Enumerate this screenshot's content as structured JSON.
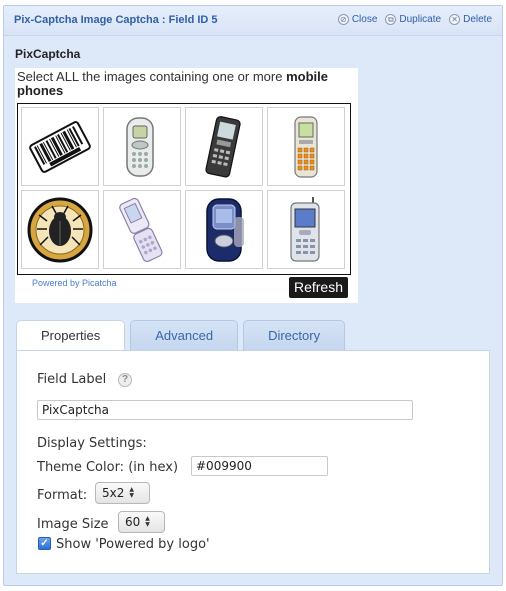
{
  "header": {
    "title": "Pix-Captcha Image Captcha : Field ID 5",
    "actions": {
      "close": "Close",
      "duplicate": "Duplicate",
      "delete": "Delete"
    }
  },
  "field_name": "PixCaptcha",
  "captcha": {
    "instruction_prefix": "Select ALL the images containing one or more",
    "instruction_bold": "mobile phones",
    "images": [
      {
        "icon": "barcode-icon"
      },
      {
        "icon": "mobile-phone-icon"
      },
      {
        "icon": "mobile-phone-icon"
      },
      {
        "icon": "mobile-phone-icon"
      },
      {
        "icon": "compass-bug-icon"
      },
      {
        "icon": "flip-phone-icon"
      },
      {
        "icon": "flip-phone-icon"
      },
      {
        "icon": "mobile-phone-icon"
      }
    ],
    "powered_by": "Powered by Picatcha",
    "refresh_label": "Refresh"
  },
  "tabs": [
    {
      "label": "Properties",
      "active": true
    },
    {
      "label": "Advanced",
      "active": false
    },
    {
      "label": "Directory",
      "active": false
    }
  ],
  "properties": {
    "field_label_title": "Field Label",
    "field_label_value": "PixCaptcha",
    "display_settings": "Display Settings:",
    "theme_color_label": "Theme Color: (in hex)",
    "theme_color_value": "#009900",
    "format_label": "Format:",
    "format_value": "5x2",
    "image_size_label": "Image Size",
    "image_size_value": "60",
    "powered_logo_label": "Show 'Powered by logo'",
    "powered_logo_checked": true
  },
  "colors": {
    "panel_bg": "#dde8f9",
    "link_blue": "#2f5fa7",
    "checkbox_blue": "#2d6fd6"
  }
}
